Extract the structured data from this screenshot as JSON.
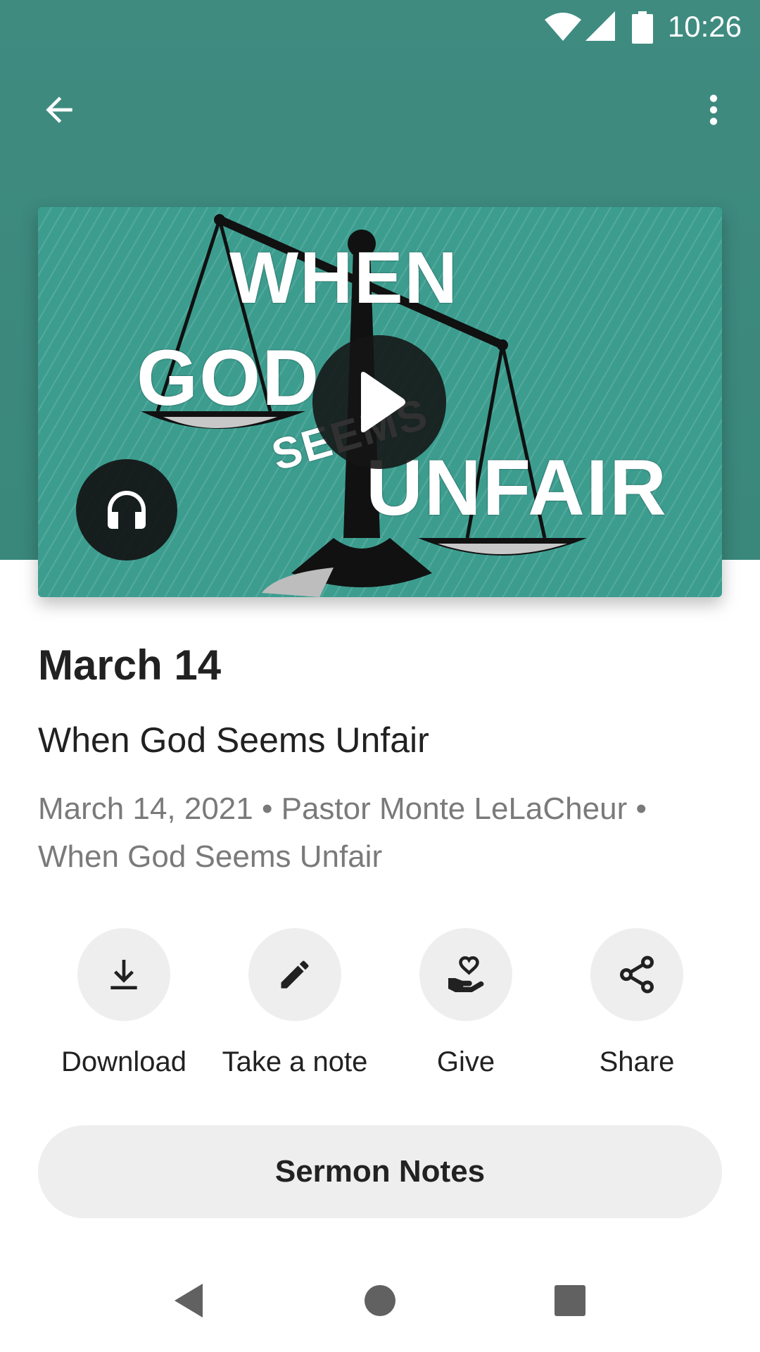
{
  "status_bar": {
    "time": "10:26"
  },
  "artwork": {
    "words": {
      "when": "WHEN",
      "god": "GOD",
      "seems": "SEEMS",
      "unfair": "UNFAIR"
    }
  },
  "sermon": {
    "title": "March 14",
    "subtitle": "When God Seems Unfair",
    "meta": "March 14, 2021 • Pastor Monte LeLaCheur • When God Seems Unfair"
  },
  "actions": [
    {
      "label": "Download",
      "icon": "download-icon"
    },
    {
      "label": "Take a note",
      "icon": "pencil-icon"
    },
    {
      "label": "Give",
      "icon": "give-heart-hand-icon"
    },
    {
      "label": "Share",
      "icon": "share-icon"
    }
  ],
  "notes_button": {
    "label": "Sermon Notes"
  },
  "colors": {
    "header": "#3f8b80",
    "artwork": "#3c9d8f",
    "button_bg": "#eeeeef",
    "meta_text": "#7a7a7a"
  }
}
